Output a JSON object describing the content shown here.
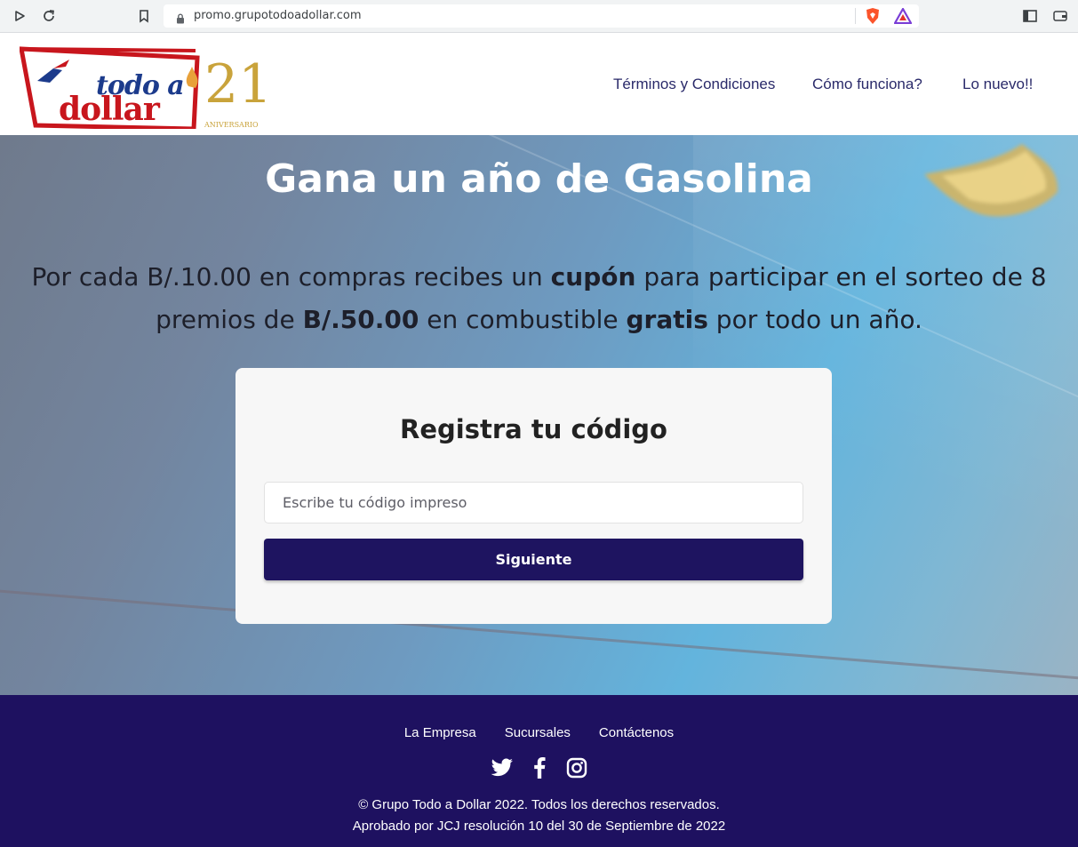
{
  "browser": {
    "url": "promo.grupotodoadollar.com"
  },
  "logo": {
    "line1": "todo a",
    "line2": "dollar",
    "anniversary_number": "21",
    "anniversary_label": "ANIVERSARIO"
  },
  "nav": {
    "items": [
      {
        "label": "Términos y Condiciones"
      },
      {
        "label": "Cómo funciona?"
      },
      {
        "label": "Lo nuevo!!"
      }
    ]
  },
  "hero": {
    "title": "Gana un año de Gasolina",
    "desc_part1": "Por cada B/.10.00 en compras recibes un ",
    "desc_bold1": "cupón",
    "desc_part2": " para participar en el sorteo de 8 premios de ",
    "desc_bold2": "B/.50.00",
    "desc_part3": " en combustible ",
    "desc_bold3": "gratis",
    "desc_part4": " por todo un año."
  },
  "form": {
    "title": "Registra tu código",
    "input_placeholder": "Escribe tu código impreso",
    "input_value": "",
    "submit_label": "Siguiente"
  },
  "footer": {
    "links": [
      {
        "label": "La Empresa"
      },
      {
        "label": "Sucursales"
      },
      {
        "label": "Contáctenos"
      }
    ],
    "social_icons": [
      "twitter-icon",
      "facebook-icon",
      "instagram-icon"
    ],
    "copyright": "© Grupo Todo a Dollar 2022. Todos los derechos reservados.",
    "approval": "Aprobado por JCJ resolución 10 del 30 de Septiembre de 2022"
  },
  "colors": {
    "brand_navy": "#1e1460",
    "logo_red": "#c8161d",
    "logo_blue": "#1c3b8c",
    "logo_gold": "#c9a33b"
  }
}
